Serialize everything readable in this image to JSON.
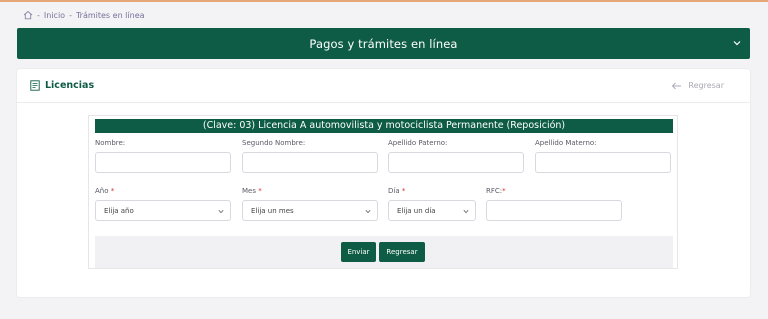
{
  "breadcrumb": {
    "home_icon": "home-icon",
    "items": [
      "Inicio",
      "Trámites en línea"
    ],
    "separator": "-"
  },
  "banner": {
    "title": "Pagos y trámites en línea",
    "toggle_icon": "chevron-down-icon"
  },
  "card": {
    "title": "Licencias",
    "title_icon": "document-icon",
    "back_label": "Regresar"
  },
  "form": {
    "heading": "(Clave: 03) Licencia A automovilista y motociclista Permanente (Reposición)",
    "fields": {
      "nombre": {
        "label": "Nombre:",
        "value": ""
      },
      "segundo_nombre": {
        "label": "Segundo Nombre:",
        "value": ""
      },
      "apellido_paterno": {
        "label": "Apellido Paterno:",
        "value": ""
      },
      "apellido_materno": {
        "label": "Apellido Materno:",
        "value": ""
      },
      "anio": {
        "label": "Año",
        "required_mark": "*",
        "selected": "Elija año"
      },
      "mes": {
        "label": "Mes",
        "required_mark": "*",
        "selected": "Elija un mes"
      },
      "dia": {
        "label": "Día",
        "required_mark": "*",
        "selected": "Elija un día"
      },
      "rfc": {
        "label": "RFC:",
        "required_mark": "*",
        "value": ""
      }
    },
    "buttons": {
      "enviar": "Enviar",
      "regresar": "Regresar"
    }
  },
  "colors": {
    "primary": "#0e5c45",
    "required": "#d0302f",
    "background": "#f3f3f5"
  }
}
